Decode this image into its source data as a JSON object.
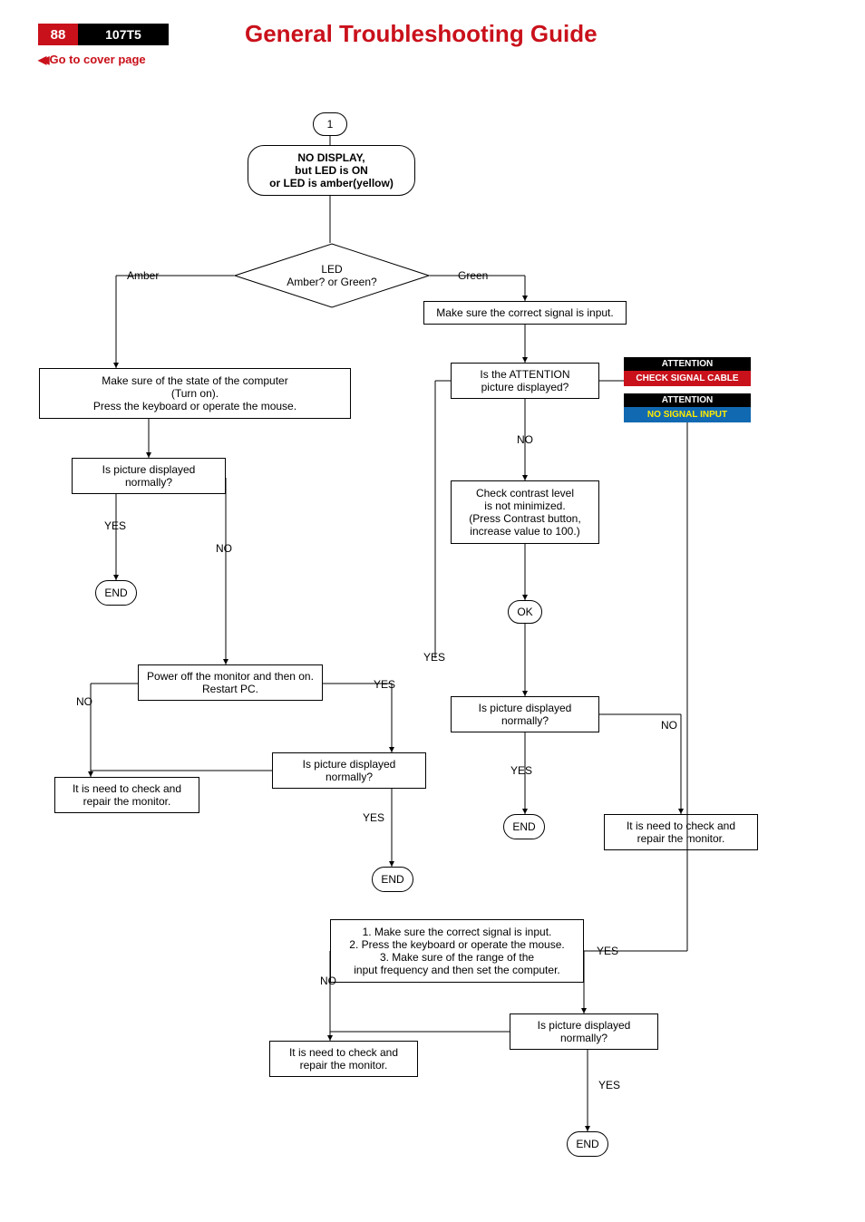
{
  "header": {
    "page_number": "88",
    "model": "107T5",
    "title": "General Troubleshooting Guide",
    "cover_link": "Go to cover page"
  },
  "flow": {
    "start_num": "1",
    "start_title": "NO DISPLAY,\nbut LED is ON\nor LED is amber(yellow)",
    "led_decision": "LED\nAmber? or Green?",
    "branch_amber": "Amber",
    "branch_green": "Green",
    "amber_check_pc": "Make sure of the state of the computer\n(Turn on).\nPress the keyboard or operate the mouse.",
    "amber_pic_norm1": "Is picture displayed\nnormally?",
    "yes": "YES",
    "no": "NO",
    "end": "END",
    "ok": "OK",
    "amber_restart": "Power off the monitor and then on.\nRestart PC.",
    "amber_pic_norm2": "Is picture displayed\nnormally?",
    "amber_repair": "It is need to check and\nrepair the monitor.",
    "green_signal": "Make sure the correct signal is input.",
    "green_attn_pic": "Is the ATTENTION\npicture displayed?",
    "attn1_hdr": "ATTENTION",
    "attn1_msg": "CHECK SIGNAL CABLE",
    "attn2_hdr": "ATTENTION",
    "attn2_msg": "NO SIGNAL INPUT",
    "green_contrast": "Check contrast level\nis not minimized.\n(Press Contrast button,\nincrease value to 100.)",
    "green_pic_norm": "Is picture displayed\nnormally?",
    "green_repair": "It is need to check and\nrepair the monitor.",
    "attn_steps": "1. Make sure the correct signal is input.\n2. Press the keyboard or operate the mouse.\n3. Make sure of the range of the\ninput frequency and then set the computer.",
    "attn_pic_norm": "Is picture displayed\nnormally?",
    "attn_repair": "It is need to check and\nrepair the monitor."
  }
}
